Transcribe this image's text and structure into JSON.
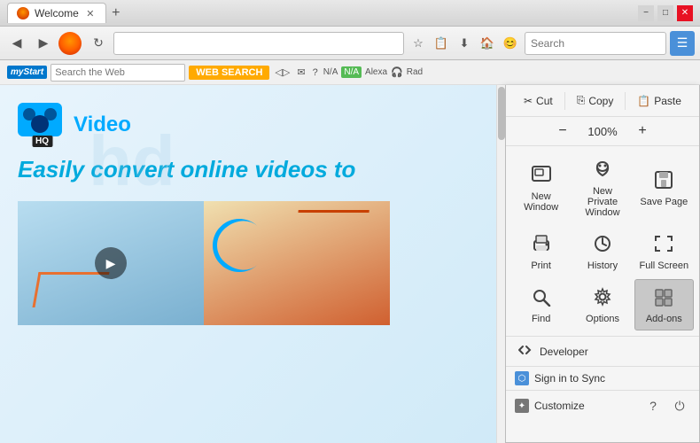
{
  "titlebar": {
    "tab_title": "Welcome",
    "new_tab_label": "+",
    "minimize": "−",
    "maximize": "□",
    "close": "✕"
  },
  "navbar": {
    "address_value": "",
    "address_placeholder": "",
    "search_placeholder": "Search"
  },
  "bookmarks": {
    "mystart_label": "myStart",
    "search_placeholder": "Search the Web",
    "web_search_btn": "WEB SEARCH",
    "na_label": "N/A",
    "alexa_label": "Alexa",
    "radio_label": "Rad"
  },
  "webcontent": {
    "hq_badge": "HQ",
    "hq_label": "Video",
    "tagline": "Easily convert online videos to",
    "watermark": "hd"
  },
  "menu": {
    "cut_label": "Cut",
    "copy_label": "Copy",
    "paste_label": "Paste",
    "zoom_value": "100%",
    "zoom_minus": "−",
    "zoom_plus": "+",
    "items": [
      {
        "id": "new-window",
        "icon": "🗔",
        "label": "New Window"
      },
      {
        "id": "private-window",
        "icon": "🎭",
        "label": "New Private Window"
      },
      {
        "id": "save-page",
        "icon": "💾",
        "label": "Save Page"
      },
      {
        "id": "print",
        "icon": "🖨",
        "label": "Print"
      },
      {
        "id": "history",
        "icon": "🕐",
        "label": "History"
      },
      {
        "id": "fullscreen",
        "icon": "⛶",
        "label": "Full Screen"
      },
      {
        "id": "find",
        "icon": "🔍",
        "label": "Find"
      },
      {
        "id": "options",
        "icon": "⚙",
        "label": "Options"
      },
      {
        "id": "addons",
        "icon": "🧩",
        "label": "Add-ons"
      }
    ],
    "developer_label": "Developer",
    "sign_in_label": "Sign in to Sync",
    "customize_label": "Customize"
  },
  "colors": {
    "accent_blue": "#4a90d9",
    "menu_bg": "#f5f5f5",
    "active_item_bg": "#c8c8c8",
    "firefox_orange": "#ff6600"
  }
}
